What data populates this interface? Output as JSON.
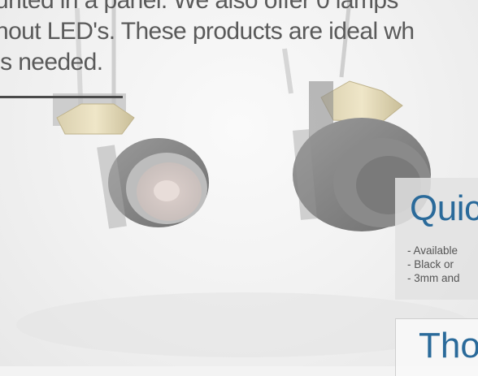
{
  "intro": {
    "lines": [
      "unted in a panel. We also offer 0 lamps",
      "hout LED's. These products are ideal wh",
      "is needed."
    ]
  },
  "quick_panel": {
    "title": "Quic",
    "items": [
      "- Available",
      "- Black or",
      "- 3mm and"
    ]
  },
  "second_panel": {
    "title": "Tho"
  },
  "colors": {
    "accent_blue": "#2a6a9a",
    "text_gray": "#5a5a5a"
  }
}
